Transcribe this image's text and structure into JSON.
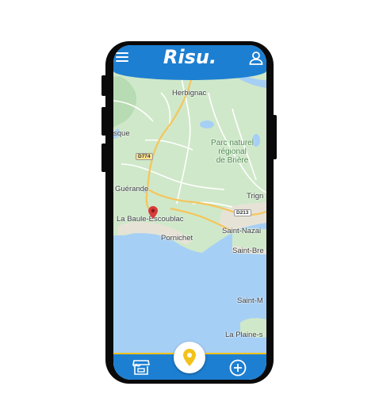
{
  "app": {
    "logo_text": "Risu.",
    "brand_color": "#1d7fd1",
    "accent_color": "#f3c21a"
  },
  "header": {
    "menu_icon": "menu-icon",
    "account_icon": "user-icon"
  },
  "map": {
    "labels": {
      "herbignac": "Herbignac",
      "sque": "sque",
      "parc": "Parc naturel\nrégional\nde Brière",
      "guerande": "Guérande",
      "trign": "Trign",
      "labaule": "La Baule-Escoublac",
      "pornichet": "Pornichet",
      "saintnazaire": "Saint-Nazai",
      "saintbrevin": "Saint-Bre",
      "saintm": "Saint-M",
      "laplaine": "La Plaine-s"
    },
    "roads": {
      "d774": "D774",
      "d213": "D213"
    },
    "pin_color": "#d93a3a"
  },
  "bottombar": {
    "store_icon": "store-icon",
    "location_icon": "location-pin-icon",
    "add_icon": "add-circle-icon"
  }
}
